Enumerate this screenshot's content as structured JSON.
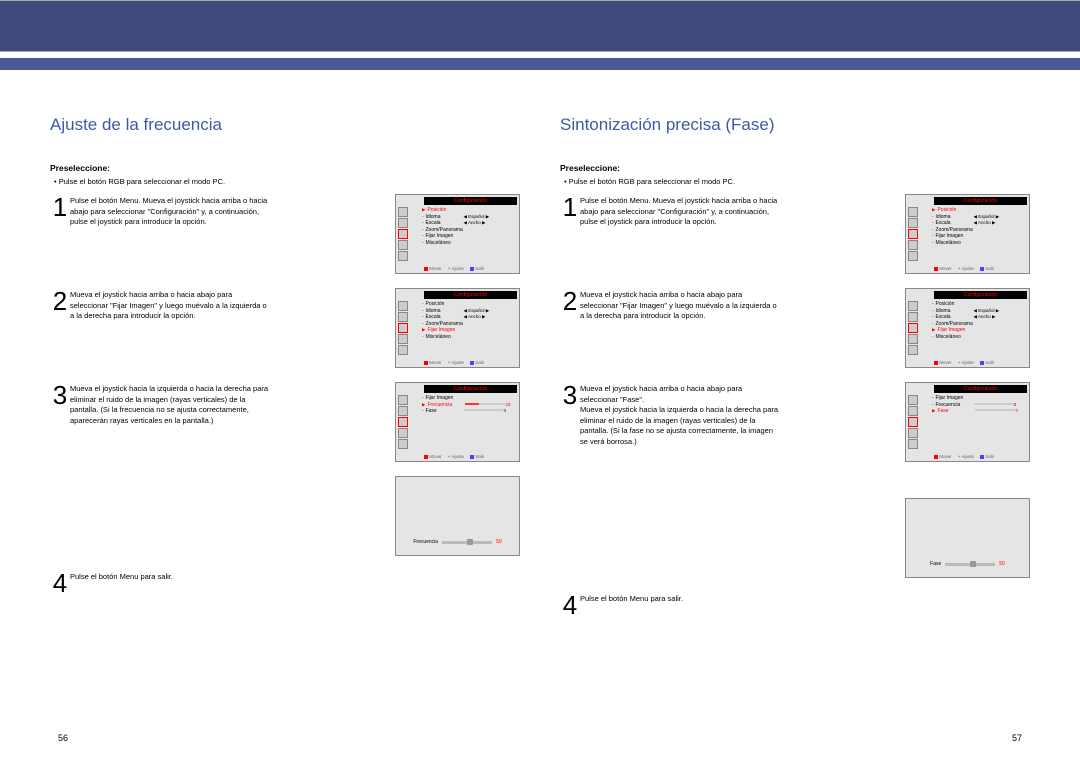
{
  "left": {
    "title": "Ajuste de la frecuencia",
    "preselect": "Preseleccione:",
    "bullet": "Pulse el botón RGB para seleccionar el modo PC.",
    "step1": "Pulse el botón Menu. Mueva el joystick hacia arriba o hacia abajo para seleccionar \"Configuración\" y, a continuación, pulse el joystick para introducir la opción.",
    "step2": "Mueva el joystick hacia arriba o hacia abajo para seleccionar \"Fijar Imagen\" y luego muévalo a la izquierda o a la derecha para introducir la opción.",
    "step3": "Mueva el joystick hacia la izquierda o hacia la derecha para eliminar el ruido de la imagen (rayas verticales) de la pantalla. (Si la frecuencia no se ajusta correctamente, aparecerán rayas verticales en la pantalla.)",
    "step4": "Pulse el botón Menu para salir.",
    "page": "56",
    "osd_header": "Configuración",
    "menu1": {
      "items": [
        "Posición",
        "Idioma",
        "Escala",
        "Zoom/Panorama",
        "Fijar Imagen",
        "Misceláneo"
      ],
      "vals": [
        "",
        "Español",
        "Ancho",
        "",
        "",
        ""
      ],
      "sel": 0
    },
    "menu2": {
      "items": [
        "Posición",
        "Idioma",
        "Escala",
        "Zoom/Panorama",
        "Fijar Imagen",
        "Misceláneo"
      ],
      "vals": [
        "",
        "Español",
        "Ancho",
        "",
        "",
        ""
      ],
      "sel": 4
    },
    "menu3": {
      "items": [
        "Fijar Imagen",
        "Frecuencia",
        "Fase"
      ],
      "bars": [
        null,
        33,
        0
      ],
      "sel": 1
    },
    "slider": {
      "label": "Frecuencia",
      "value": "50"
    },
    "footer": {
      "mover": "Mover",
      "ajuste": "Ajuste",
      "salir": "Salir"
    }
  },
  "right": {
    "title": "Sintonización precisa (Fase)",
    "preselect": "Preseleccione:",
    "bullet": "Pulse el botón RGB para seleccionar el modo PC.",
    "step1": "Pulse el botón Menu. Mueva el joystick hacia arriba o hacia abajo para seleccionar \"Configuración\" y, a continuación, pulse el joystick para introducir la opción.",
    "step2": "Mueva el joystick hacia arriba o hacia abajo para seleccionar \"Fijar Imagen\" y luego muévalo a la izquierda o a la derecha para introducir la opción.",
    "step3a": "Mueva el joystick hacia arriba o hacia abajo para seleccionar \"Fase\".",
    "step3b": "Mueva el joystick hacia la izquierda o hacia la derecha para eliminar el ruido de la imagen (rayas verticales) de la pantalla. (Si la fase no se ajusta correctamente, la imagen se verá borrosa.)",
    "step4": "Pulse el botón Menu para salir.",
    "page": "57",
    "menu3": {
      "items": [
        "Fijar Imagen",
        "Frecuencia",
        "Fase"
      ],
      "bars": [
        null,
        0,
        0
      ],
      "sel": 2
    },
    "slider": {
      "label": "Fase",
      "value": "50"
    }
  }
}
